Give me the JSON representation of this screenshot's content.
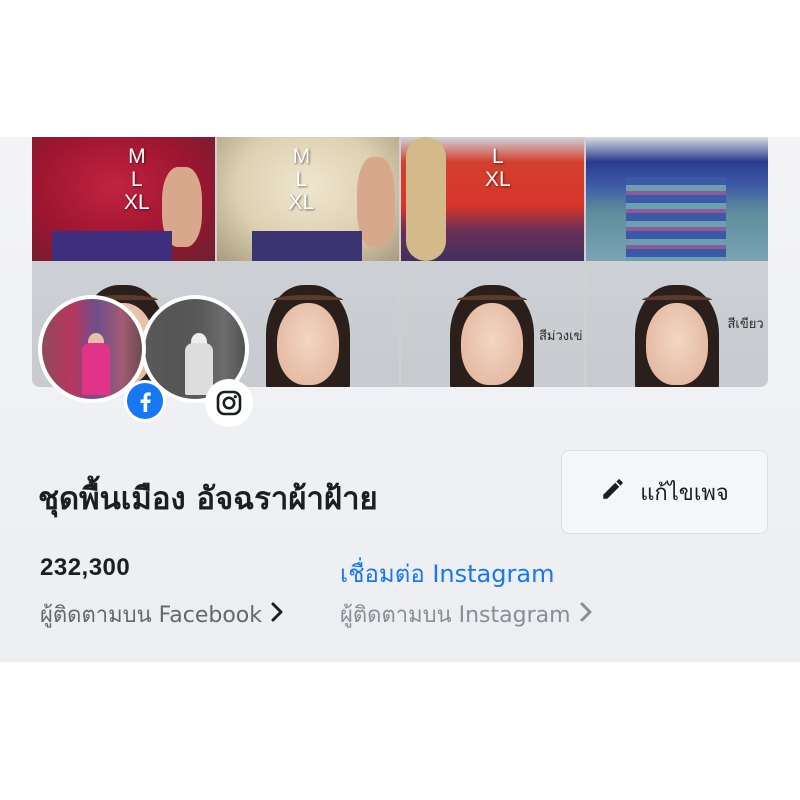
{
  "page": {
    "name": "ชุดพื้นเมือง อัจฉราผ้าฝ้าย",
    "edit_button_label": "แก้ไขเพจ"
  },
  "cover": {
    "tiles_top": [
      {
        "sizes": "M\nL\nXL"
      },
      {
        "sizes": "M\nL\nXL"
      },
      {
        "sizes": "L\nXL"
      },
      {
        "sizes": ""
      }
    ],
    "captions": [
      "สีม่วงเข่",
      "สีเขียว"
    ]
  },
  "stats": {
    "facebook_followers": "232,300",
    "facebook_label": "ผู้ติดตามบน Facebook",
    "instagram_connect": "เชื่อมต่อ Instagram",
    "instagram_label": "ผู้ติดตามบน Instagram"
  },
  "colors": {
    "facebook_blue": "#1877f2",
    "link_blue": "#1877f2",
    "text_primary": "#1c1e21",
    "text_secondary": "#65676b"
  },
  "icons": {
    "facebook_badge": "facebook-icon",
    "instagram_badge": "instagram-icon",
    "edit": "pencil-icon",
    "chevron": "chevron-right-icon"
  }
}
